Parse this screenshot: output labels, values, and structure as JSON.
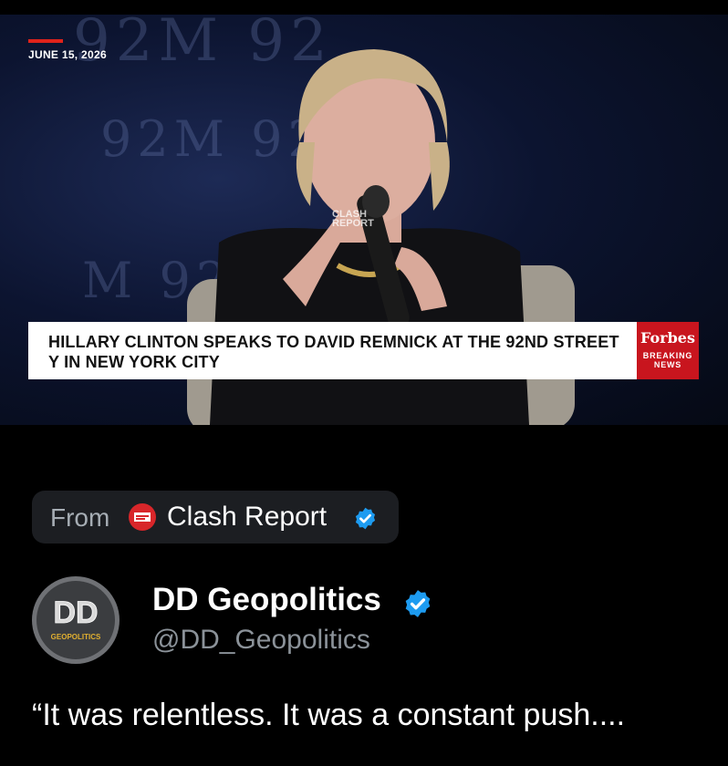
{
  "video": {
    "date": "JUNE 15, 2026",
    "backdrop_text": [
      "92M 92",
      "92M 92",
      "M 92"
    ],
    "watermark_line1": "CLASH",
    "watermark_line2": "REPORT",
    "lower_third": "HILLARY CLINTON SPEAKS TO DAVID REMNICK AT THE 92ND STREET Y IN NEW YORK CITY",
    "network_brand": "Forbes",
    "network_sub_line1": "BREAKING",
    "network_sub_line2": "NEWS",
    "logo_colors": {
      "accent": "#e0231b",
      "forbes": "#c8151e"
    }
  },
  "source": {
    "from_label": "From",
    "logo_icon": "clash-report-logo-icon",
    "name": "Clash Report",
    "verified_icon": "verified-badge-icon"
  },
  "post": {
    "avatar_icon": "dd-geopolitics-avatar",
    "avatar_text": "DD",
    "avatar_caption": "GEOPOLITICS",
    "author_name": "DD Geopolitics",
    "verified_icon": "verified-badge-icon",
    "handle": "@DD_Geopolitics",
    "text": "“It was relentless. It was a constant push...."
  },
  "colors": {
    "background": "#000000",
    "verified": "#1d9bf0",
    "pill": "#1c1e22",
    "muted_text": "#8b9299"
  }
}
